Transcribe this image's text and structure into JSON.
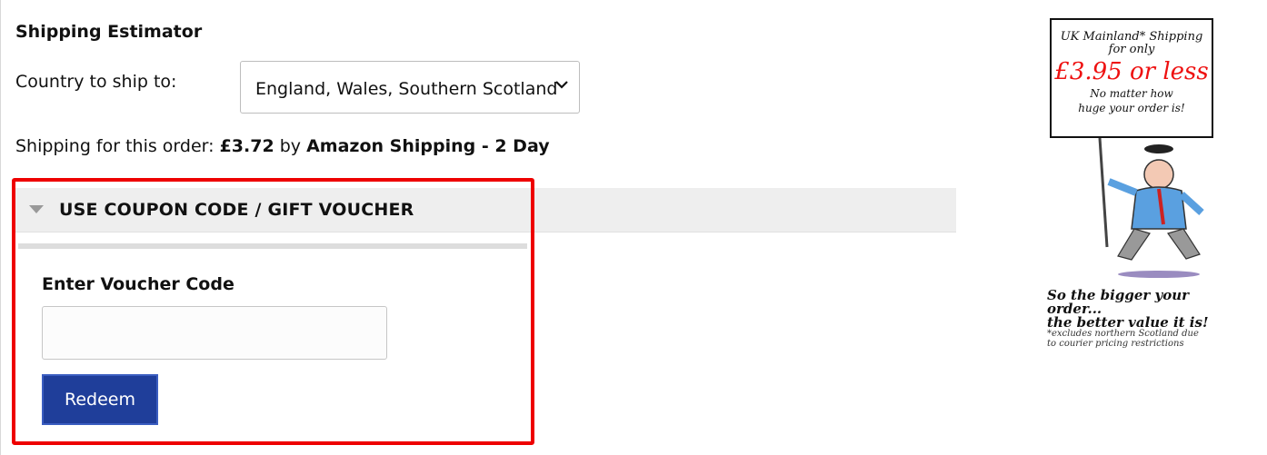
{
  "shipping_estimator": {
    "title": "Shipping Estimator",
    "country_label": "Country to ship to:",
    "country_selected": "England, Wales, Southern Scotland",
    "shipping_prefix": "Shipping for this order:",
    "shipping_amount": "£3.72",
    "shipping_by": "by",
    "shipping_method": "Amazon Shipping - 2 Day"
  },
  "coupon": {
    "title": "USE COUPON CODE / GIFT VOUCHER",
    "field_label": "Enter Voucher Code",
    "field_value": "",
    "redeem_label": "Redeem"
  },
  "promo": {
    "sign_line1": "UK Mainland* Shipping",
    "sign_line2": "for only",
    "sign_price": "£3.95 or less",
    "sign_line4a": "No matter how",
    "sign_line4b": "huge your order is!",
    "tagline_1": "So the bigger your order...",
    "tagline_2": "the better value it is!",
    "note_1": "*excludes northern Scotland due",
    "note_2": "to courier pricing restrictions"
  },
  "colors": {
    "highlight_border": "#ee0000",
    "button_bg": "#1f3e9a",
    "price_red": "#e11111"
  }
}
